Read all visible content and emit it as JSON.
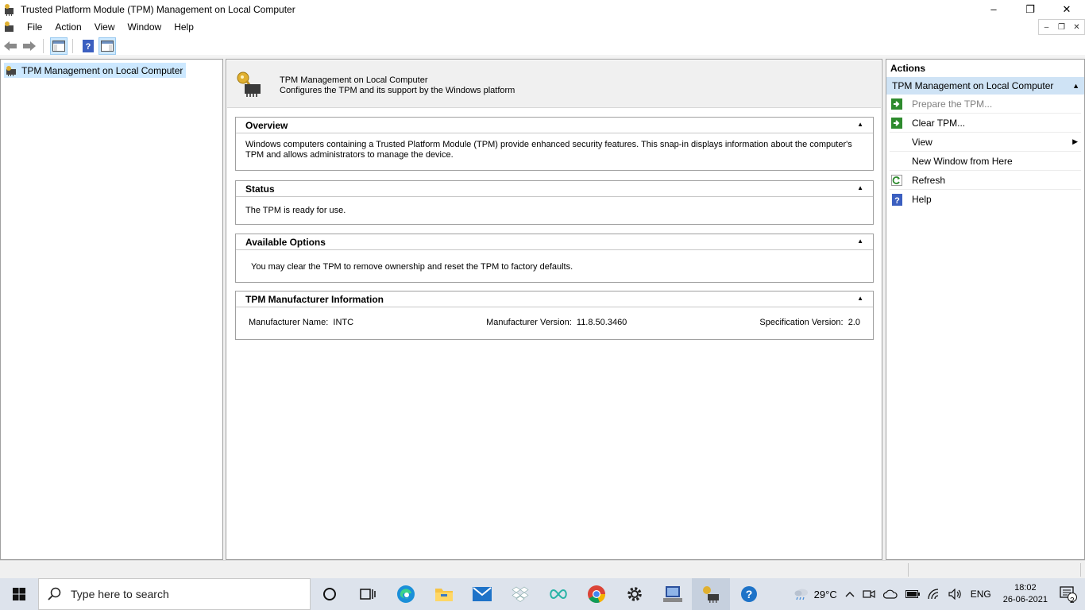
{
  "window": {
    "title": "Trusted Platform Module (TPM) Management on Local Computer",
    "minimize": "–",
    "maximize": "❐",
    "close": "✕"
  },
  "menu": {
    "items": [
      "File",
      "Action",
      "View",
      "Window",
      "Help"
    ]
  },
  "tree": {
    "root_label": "TPM Management on Local Computer"
  },
  "header": {
    "title": "TPM Management on Local Computer",
    "subtitle": "Configures the TPM and its support by the Windows platform"
  },
  "sections": {
    "overview": {
      "title": "Overview",
      "text": "Windows computers containing a Trusted Platform Module (TPM) provide enhanced security features. This snap-in displays information about the computer's TPM and allows administrators to manage the device."
    },
    "status": {
      "title": "Status",
      "text": "The TPM is ready for use."
    },
    "options": {
      "title": "Available Options",
      "text": "You may clear the TPM to remove ownership and reset the TPM to factory defaults."
    },
    "manufacturer": {
      "title": "TPM Manufacturer Information",
      "name_label": "Manufacturer Name:",
      "name_value": "INTC",
      "version_label": "Manufacturer Version:",
      "version_value": "11.8.50.3460",
      "spec_label": "Specification Version:",
      "spec_value": "2.0"
    }
  },
  "actions": {
    "header": "Actions",
    "selected": "TPM Management on Local Computer",
    "items": {
      "prepare": "Prepare the TPM...",
      "clear": "Clear TPM...",
      "view": "View",
      "new_window": "New Window from Here",
      "refresh": "Refresh",
      "help": "Help"
    }
  },
  "taskbar": {
    "search_placeholder": "Type here to search",
    "weather": "29°C",
    "language": "ENG",
    "time": "18:02",
    "date": "26-06-2021",
    "notifications": "2"
  },
  "colors": {
    "selection": "#cce8ff",
    "actions_selected": "#cfe3f5",
    "panel_bg": "#f0f0f0",
    "taskbar_bg": "#dde3ec",
    "action_green": "#2e8b2e",
    "help_blue": "#3b5fc0"
  }
}
